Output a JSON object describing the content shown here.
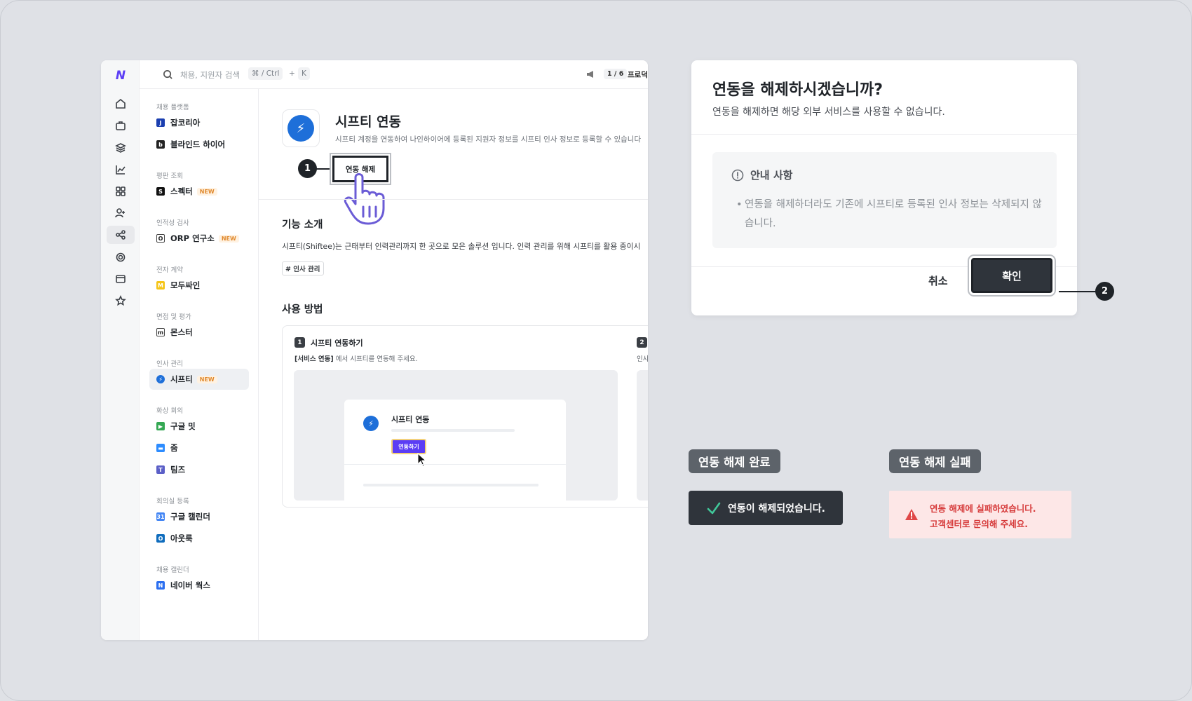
{
  "top_bar": {
    "search_placeholder": "채용, 지원자 검색",
    "shortcut_mod": "⌘ / Ctrl",
    "shortcut_plus": "+",
    "shortcut_key": "K",
    "pager": "1 / 6",
    "product_text": "프로덕트"
  },
  "menu": {
    "categories": [
      {
        "label": "채용 플랫폼",
        "items": [
          {
            "label": "잡코리아",
            "icon": "jobkorea-icon",
            "icon_text": "J",
            "color": "#1b3fb0"
          },
          {
            "label": "블라인드 하이어",
            "icon": "blind-icon",
            "icon_text": "b",
            "color": "#222222"
          }
        ]
      },
      {
        "label": "평판 조회",
        "items": [
          {
            "label": "스펙터",
            "icon": "specter-icon",
            "icon_text": "S",
            "color": "#111111",
            "new": "NEW"
          }
        ]
      },
      {
        "label": "인적성 검사",
        "items": [
          {
            "label": "ORP 연구소",
            "icon": "orp-icon",
            "icon_text": "O",
            "color": "#ffffff",
            "new": "NEW"
          }
        ]
      },
      {
        "label": "전자 계약",
        "items": [
          {
            "label": "모두싸인",
            "icon": "modusign-icon",
            "icon_text": "M",
            "color": "#f5c518"
          }
        ]
      },
      {
        "label": "면접 및 평가",
        "items": [
          {
            "label": "몬스터",
            "icon": "monster-icon",
            "icon_text": "m",
            "color": "#ffffff"
          }
        ]
      },
      {
        "label": "인사 관리",
        "items": [
          {
            "label": "시프티",
            "icon": "shiftee-icon",
            "icon_text": "⚡",
            "color": "#1e6fd9",
            "new": "NEW",
            "active": true
          }
        ]
      },
      {
        "label": "화상 회의",
        "items": [
          {
            "label": "구글 밋",
            "icon": "google-meet-icon",
            "icon_text": "▶",
            "color": "#34a853"
          },
          {
            "label": "줌",
            "icon": "zoom-icon",
            "icon_text": "▬",
            "color": "#2d8cff"
          },
          {
            "label": "팀즈",
            "icon": "teams-icon",
            "icon_text": "T",
            "color": "#5b5fc7"
          }
        ]
      },
      {
        "label": "회의실 등록",
        "items": [
          {
            "label": "구글 캘린더",
            "icon": "google-calendar-icon",
            "icon_text": "31",
            "color": "#4285f4"
          },
          {
            "label": "아웃룩",
            "icon": "outlook-icon",
            "icon_text": "O",
            "color": "#0f6cbd"
          }
        ]
      },
      {
        "label": "채용 캘린더",
        "items": [
          {
            "label": "네이버 웍스",
            "icon": "naver-works-icon",
            "icon_text": "N",
            "color": "#2c6ff0"
          }
        ]
      }
    ]
  },
  "detail": {
    "title": "시프티 연동",
    "description": "시프티 계정을 연동하여 나인하이어에 등록된 지원자 정보를 시프티 인사 정보로 등록할 수 있습니다",
    "unlink_button": "연동 해제",
    "step_marker_1": "1",
    "features_title": "기능 소개",
    "features_text": "시프티(Shiftee)는 근태부터 인력관리까지 한 곳으로 모은 솔루션 입니다. 인력 관리를 위해 시프티를  활용 중이시",
    "tag": "# 인사 관리",
    "usage_title": "사용 방법",
    "step1_num": "1",
    "step1_title": "시프티 연동하기",
    "step1_desc_bold": "[서비스 연동]",
    "step1_desc_rest": " 에서 시프티를 연동해 주세요.",
    "step2_num": "2",
    "step2_desc": "인사",
    "mock_title": "시프티 연동",
    "mock_button": "연동하기"
  },
  "modal": {
    "title": "연동을 해제하시겠습니까?",
    "subtitle": "연동을 해제하면 해당 외부 서비스를 사용할 수 없습니다.",
    "notice_title": "안내 사항",
    "notice_body": "연동을 해제하더라도 기존에 시프티로 등록된 인사 정보는 삭제되지 않습니다.",
    "cancel": "취소",
    "confirm": "확인",
    "step_marker_2": "2"
  },
  "toasts": {
    "success_label": "연동 해제 완료",
    "success_text": "연동이 해제되었습니다.",
    "fail_label": "연동 해제 실패",
    "fail_line1": "연동 해제에 실패하였습니다.",
    "fail_line2": "고객센터로 문의해 주세요."
  },
  "colors": {
    "accent_purple": "#5b3df5",
    "shiftee_blue": "#1e6fd9",
    "dark_button": "#2f343b",
    "error_red": "#d63a3a",
    "new_badge": "#e0892d"
  }
}
